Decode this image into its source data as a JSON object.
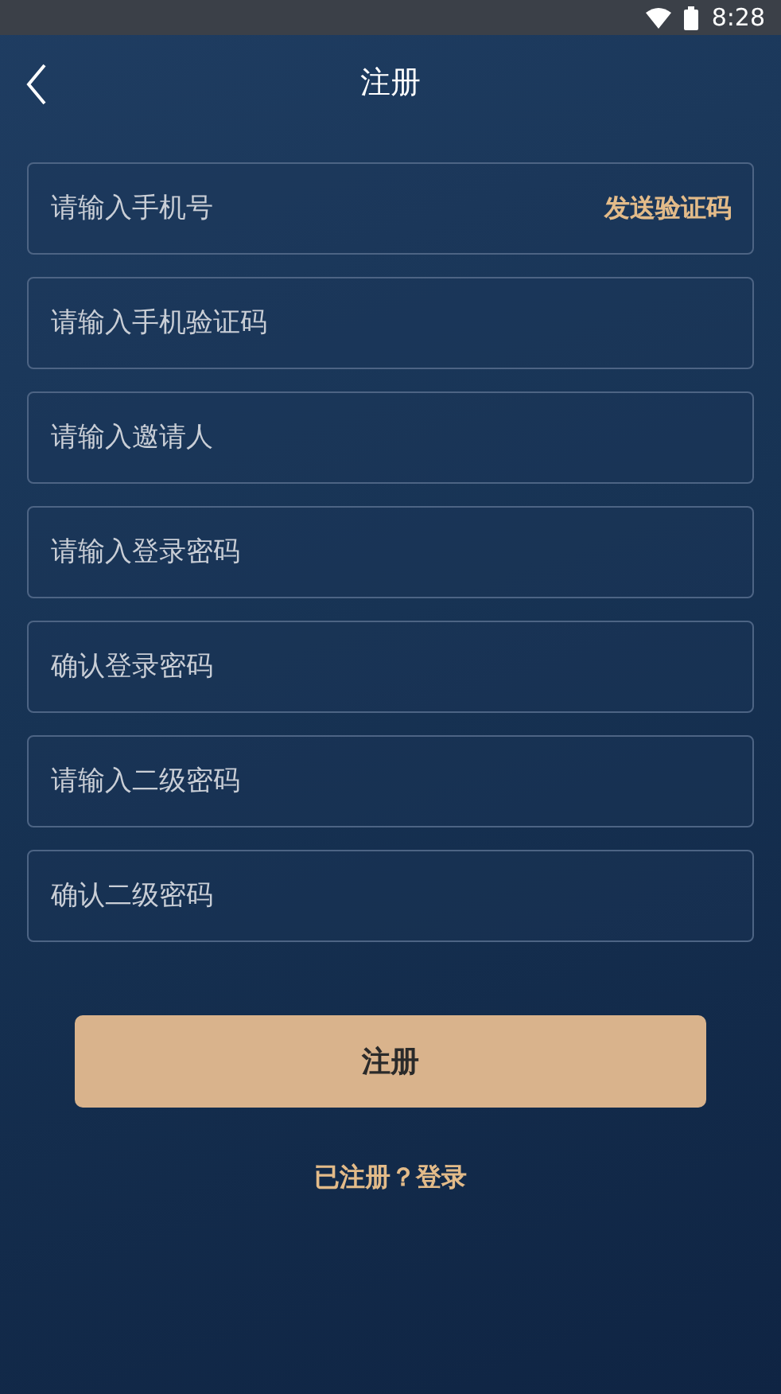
{
  "status_bar": {
    "time": "8:28"
  },
  "header": {
    "title": "注册"
  },
  "fields": [
    {
      "placeholder": "请输入手机号",
      "action": "发送验证码"
    },
    {
      "placeholder": "请输入手机验证码"
    },
    {
      "placeholder": "请输入邀请人"
    },
    {
      "placeholder": "请输入登录密码"
    },
    {
      "placeholder": "确认登录密码"
    },
    {
      "placeholder": "请输入二级密码"
    },
    {
      "placeholder": "确认二级密码"
    }
  ],
  "submit_button": "注册",
  "footer": {
    "prompt": "已注册？",
    "link": "登录"
  }
}
